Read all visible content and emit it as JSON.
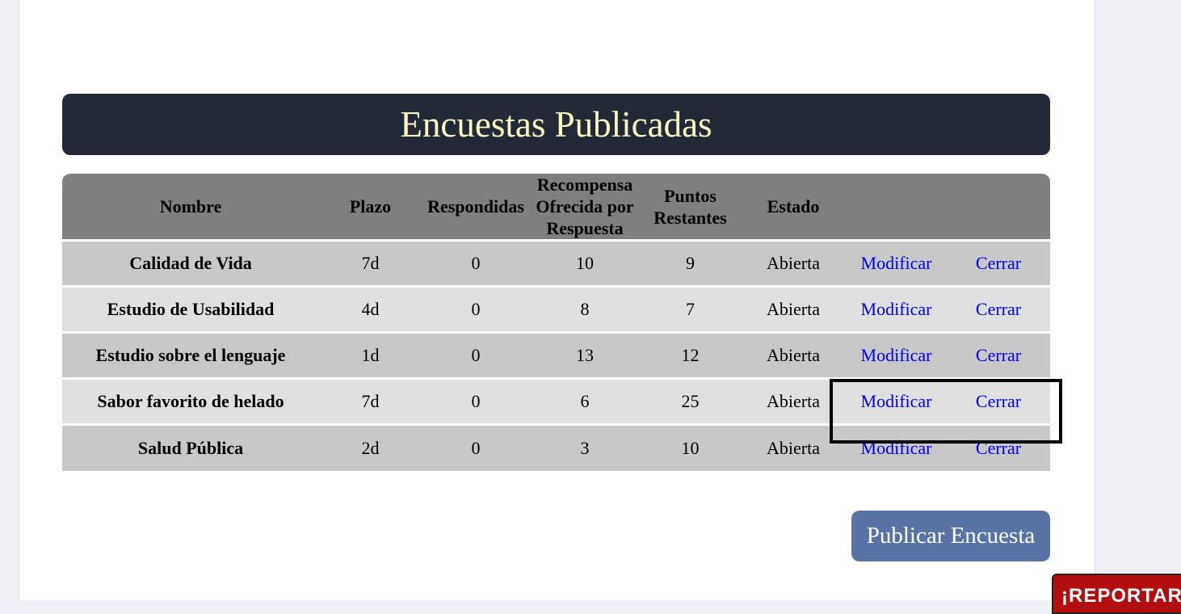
{
  "header": {
    "title": "Encuestas Publicadas"
  },
  "table": {
    "columns": [
      "Nombre",
      "Plazo",
      "Respondidas",
      "Recompensa Ofrecida por Respuesta",
      "Puntos Restantes",
      "Estado",
      "",
      ""
    ],
    "rows": [
      {
        "name": "Calidad de Vida",
        "deadline": "7d",
        "answered": "0",
        "reward": "10",
        "points_left": "9",
        "status": "Abierta",
        "modify": "Modificar",
        "close": "Cerrar"
      },
      {
        "name": "Estudio de Usabilidad",
        "deadline": "4d",
        "answered": "0",
        "reward": "8",
        "points_left": "7",
        "status": "Abierta",
        "modify": "Modificar",
        "close": "Cerrar"
      },
      {
        "name": "Estudio sobre el lenguaje",
        "deadline": "1d",
        "answered": "0",
        "reward": "13",
        "points_left": "12",
        "status": "Abierta",
        "modify": "Modificar",
        "close": "Cerrar"
      },
      {
        "name": "Sabor favorito de helado",
        "deadline": "7d",
        "answered": "0",
        "reward": "6",
        "points_left": "25",
        "status": "Abierta",
        "modify": "Modificar",
        "close": "Cerrar"
      },
      {
        "name": "Salud Pública",
        "deadline": "2d",
        "answered": "0",
        "reward": "3",
        "points_left": "10",
        "status": "Abierta",
        "modify": "Modificar",
        "close": "Cerrar"
      }
    ]
  },
  "actions": {
    "publish_label": "Publicar Encuesta"
  },
  "report_tab": {
    "label": "¡REPORTAR"
  },
  "colors": {
    "title_bar_bg": "#222937",
    "title_text": "#fdf7c3",
    "header_row_bg": "#7f7f7f",
    "row_odd_bg": "#c8c8c8",
    "row_even_bg": "#e0e0e0",
    "link": "#0000ee",
    "publish_button_bg": "#5a73a7",
    "report_tab_bg": "#b30e0e"
  }
}
